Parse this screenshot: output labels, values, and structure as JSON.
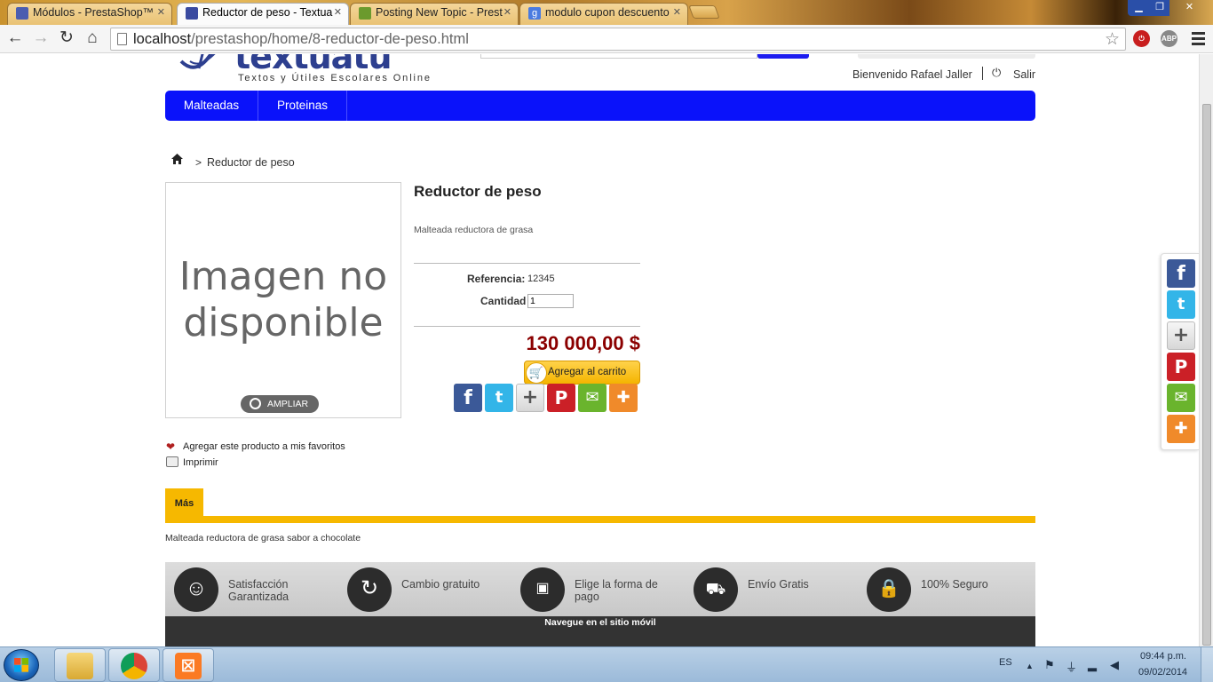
{
  "browser": {
    "tabs": [
      {
        "title": "Módulos - PrestaShop™",
        "active": false
      },
      {
        "title": "Reductor de peso - Textua",
        "active": true
      },
      {
        "title": "Posting New Topic - Prest",
        "active": false
      },
      {
        "title": "modulo cupon descuento",
        "active": false
      }
    ],
    "url_host": "localhost",
    "url_path": "/prestashop/home/8-reductor-de-peso.html",
    "extensions": [
      "abp-icon"
    ],
    "abp_label": "ABP"
  },
  "header": {
    "logo_word": "textuatu",
    "logo_tagline": "Textos y Útiles Escolares Online",
    "welcome": "Bienvenido Rafael Jaller",
    "logout": "Salir"
  },
  "nav": {
    "items": [
      "Malteadas",
      "Proteinas"
    ],
    "accent": "#0a12fa"
  },
  "breadcrumb": {
    "separator": ">",
    "current": "Reductor de peso"
  },
  "product": {
    "image_placeholder": "Imagen no disponible",
    "zoom_label": "AMPLIAR",
    "title": "Reductor de peso",
    "short_description": "Malteada reductora de grasa",
    "reference_label": "Referencia:",
    "reference": "12345",
    "quantity_label": "Cantidad",
    "quantity": "1",
    "price": "130 000,00 $",
    "price_color": "#8b0000",
    "add_to_cart": "Agregar al carrito",
    "favorite": "Agregar este producto a mis favoritos",
    "print": "Imprimir"
  },
  "share_icons": [
    "facebook-icon",
    "twitter-icon",
    "plus-icon",
    "pinterest-icon",
    "email-icon",
    "stumble-icon"
  ],
  "tabs_section": {
    "tab_label": "Más",
    "long_description": "Malteada reductora de grasa sabor a chocolate"
  },
  "reassurance": [
    {
      "icon": "smiley-icon",
      "label": "Satisfacción Garantizada"
    },
    {
      "icon": "refresh-icon",
      "label": "Cambio gratuito"
    },
    {
      "icon": "card-icon",
      "label": "Elige la forma de pago"
    },
    {
      "icon": "truck-icon",
      "label": "Envío Gratis"
    },
    {
      "icon": "lock-icon",
      "label": "100% Seguro"
    }
  ],
  "footer": {
    "mobile_link": "Navegue en el sitio móvil"
  },
  "taskbar": {
    "lang": "ES",
    "time": "09:44 p.m.",
    "date": "09/02/2014"
  }
}
